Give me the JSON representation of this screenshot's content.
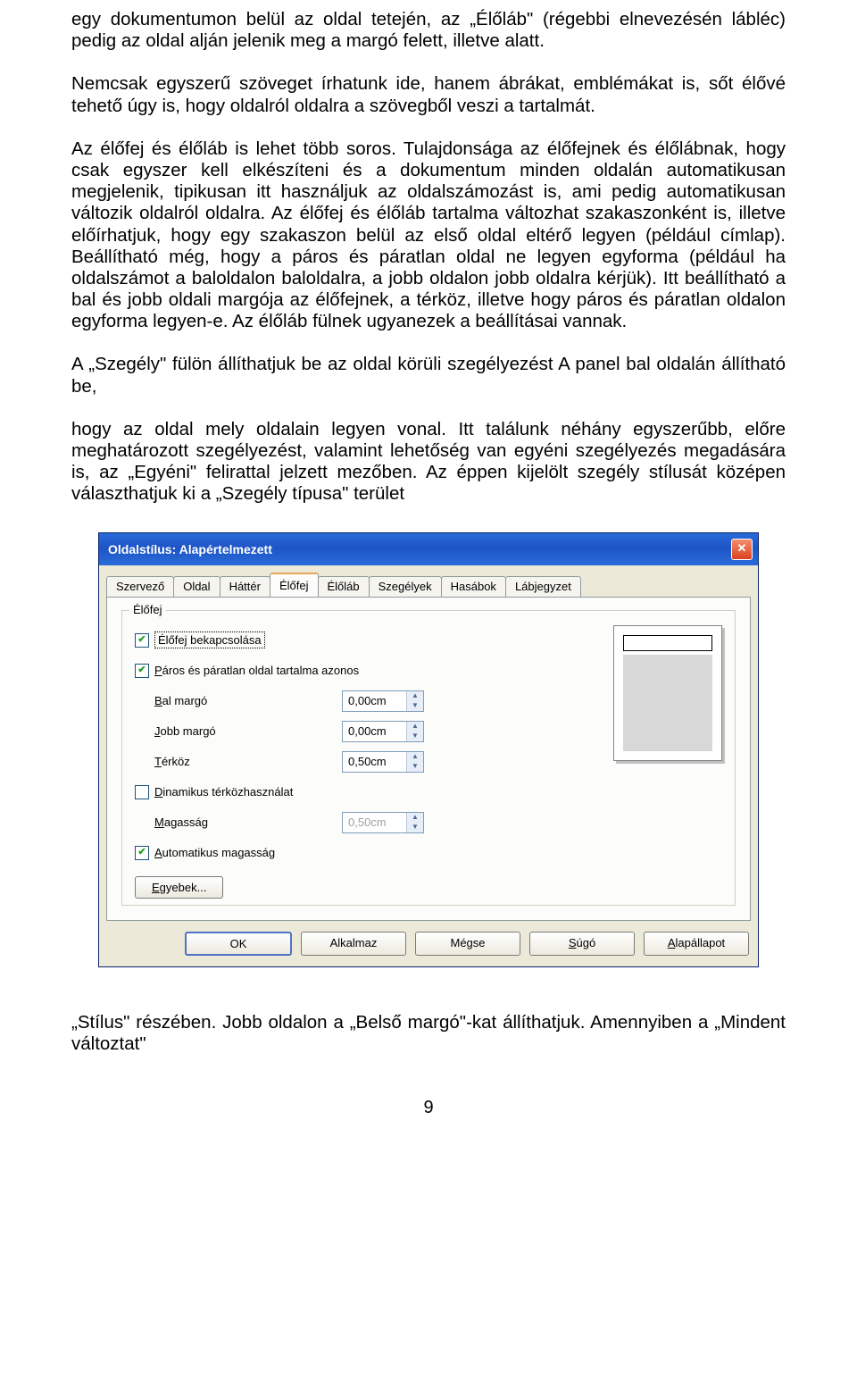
{
  "para1": "egy dokumentumon belül az oldal tetején, az „Élőláb\" (régebbi elnevezésén lábléc) pedig az oldal alján jelenik meg a margó felett, illetve alatt.",
  "para2": "Nemcsak egyszerű szöveget írhatunk ide, hanem ábrákat, emblémákat is, sőt élővé tehető úgy is, hogy oldalról oldalra a szövegből veszi a tartalmát.",
  "para3": "Az élőfej és élőláb is lehet több soros. Tulajdonsága az élőfejnek és élőlábnak, hogy csak egyszer kell elkészíteni és a dokumentum minden oldalán automatikusan megjelenik, tipikusan itt használjuk az oldalszámozást is, ami pedig automatikusan változik oldalról oldalra. Az élőfej és élőláb tartalma változhat szakaszonként is, illetve előírhatjuk, hogy egy szakaszon belül az első oldal eltérő legyen (például címlap). Beállítható még, hogy a páros és páratlan oldal ne legyen egyforma (például ha oldalszámot a baloldalon baloldalra, a jobb oldalon jobb oldalra kérjük). Itt beállítható a bal és jobb oldali margója az élőfejnek, a térköz, illetve hogy páros és páratlan oldalon egyforma legyen-e. Az élőláb fülnek ugyanezek a beállításai vannak.",
  "para4": "A „Szegély\" fülön állíthatjuk be az oldal körüli szegélyezést A panel bal oldalán állítható be,",
  "para5": "hogy az oldal mely oldalain legyen vonal. Itt találunk néhány egyszerűbb, előre meghatározott szegélyezést, valamint lehetőség van egyéni szegélyezés megadására is, az „Egyéni\" felirattal jelzett mezőben. Az éppen kijelölt szegély stílusát középen választhatjuk ki a „Szegély típusa\" terület",
  "para6": " „Stílus\" részében. Jobb oldalon a „Belső margó\"-kat állíthatjuk. Amennyiben a „Mindent változtat\"",
  "page_number": "9",
  "dialog": {
    "title": "Oldalstílus: Alapértelmezett",
    "tabs": [
      "Szervező",
      "Oldal",
      "Háttér",
      "Élőfej",
      "Élőláb",
      "Szegélyek",
      "Hasábok",
      "Lábjegyzet"
    ],
    "group_label": "Élőfej",
    "checkbox_enable": "Élőfej bekapcsolása",
    "checkbox_same": "Páros és páratlan oldal tartalma azonos",
    "label_left": "Bal margó",
    "label_right": "Jobb margó",
    "label_spacing": "Térköz",
    "checkbox_dynamic": "Dinamikus térközhasználat",
    "label_height": "Magasság",
    "checkbox_auto": "Automatikus magasság",
    "val_left": "0,00cm",
    "val_right": "0,00cm",
    "val_spacing": "0,50cm",
    "val_height": "0,50cm",
    "btn_extras": "Egyebek...",
    "btn_ok": "OK",
    "btn_apply": "Alkalmaz",
    "btn_cancel": "Mégse",
    "btn_help": "Súgó",
    "btn_reset": "Alapállapot"
  }
}
